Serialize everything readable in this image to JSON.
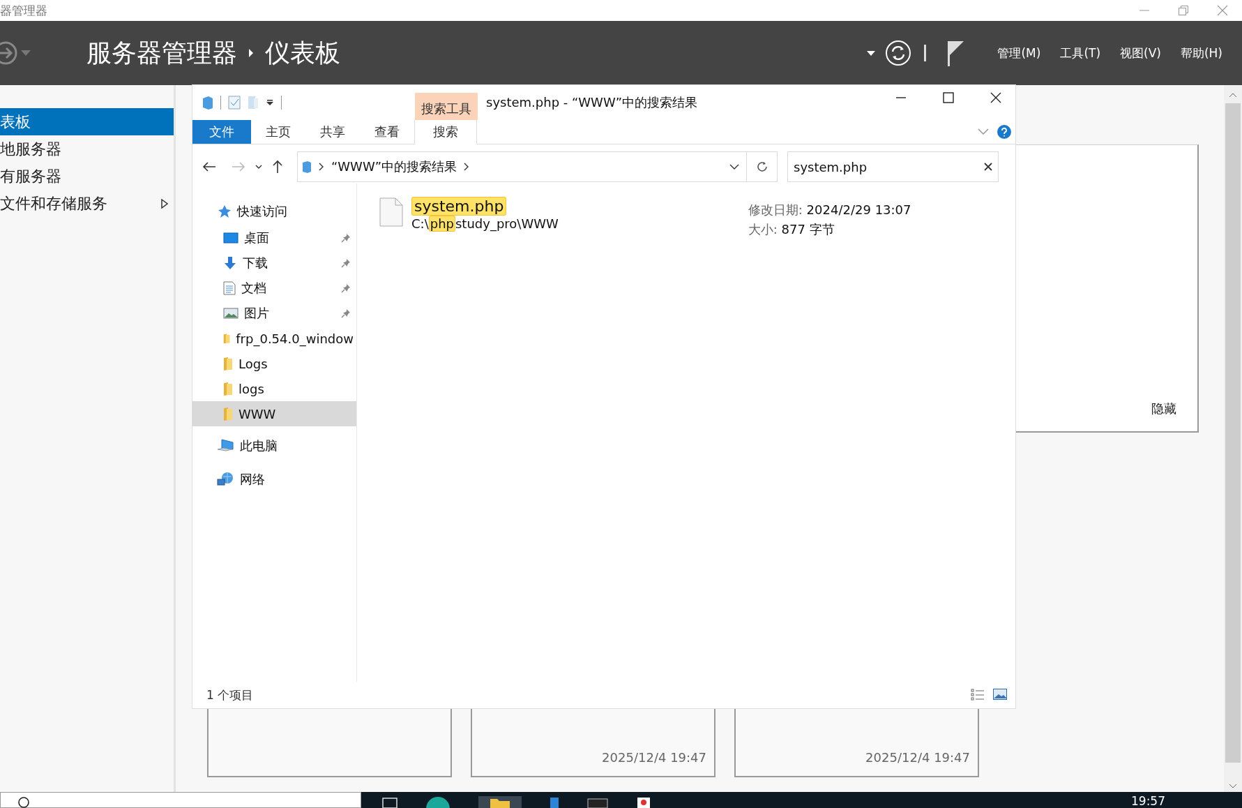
{
  "window": {
    "title": "器管理器"
  },
  "header": {
    "breadcrumb": [
      "服务器管理器",
      "仪表板"
    ],
    "menus": [
      "管理(M)",
      "工具(T)",
      "视图(V)",
      "帮助(H)"
    ]
  },
  "sidebar": {
    "items": [
      {
        "label": "表板",
        "selected": true,
        "expandable": false
      },
      {
        "label": "地服务器",
        "selected": false,
        "expandable": false
      },
      {
        "label": "有服务器",
        "selected": false,
        "expandable": false
      },
      {
        "label": "文件和存储服务",
        "selected": false,
        "expandable": true
      }
    ]
  },
  "dashboard": {
    "panel_link": "隐藏",
    "tiles": [
      {
        "kind": "empty"
      },
      {
        "kind": "dated",
        "timestamp": "2025/12/4 19:47"
      },
      {
        "kind": "dated",
        "timestamp": "2025/12/4 19:47"
      }
    ]
  },
  "explorer": {
    "title": "system.php - “WWW”中的搜索结果",
    "context_tab": "搜索工具",
    "ribbon_tabs": [
      {
        "label": "文件",
        "kind": "file",
        "selected": false
      },
      {
        "label": "主页",
        "kind": "tab",
        "selected": false
      },
      {
        "label": "共享",
        "kind": "tab",
        "selected": false
      },
      {
        "label": "查看",
        "kind": "tab",
        "selected": false
      },
      {
        "label": "搜索",
        "kind": "tab",
        "selected": true
      }
    ],
    "address": "“WWW”中的搜索结果",
    "search": {
      "value": "system.php"
    },
    "nav": [
      {
        "label": "快速访问",
        "kind": "star",
        "selected": false,
        "children": [
          {
            "label": "桌面",
            "kind": "desktop",
            "pinned": true,
            "selected": false
          },
          {
            "label": "下载",
            "kind": "download",
            "pinned": true,
            "selected": false
          },
          {
            "label": "文档",
            "kind": "document",
            "pinned": true,
            "selected": false
          },
          {
            "label": "图片",
            "kind": "pictures",
            "pinned": true,
            "selected": false
          },
          {
            "label": "frp_0.54.0_window",
            "kind": "folder",
            "pinned": false,
            "selected": false
          },
          {
            "label": "Logs",
            "kind": "folder",
            "pinned": false,
            "selected": false
          },
          {
            "label": "logs",
            "kind": "folder",
            "pinned": false,
            "selected": false
          },
          {
            "label": "WWW",
            "kind": "folder",
            "pinned": false,
            "selected": true
          }
        ]
      },
      {
        "label": "此电脑",
        "kind": "pc",
        "selected": false
      },
      {
        "label": "网络",
        "kind": "network",
        "selected": false
      }
    ],
    "results": [
      {
        "name": "system.php",
        "name_match": true,
        "path": [
          {
            "text": "C:\\",
            "match": false
          },
          {
            "text": "php",
            "match": true
          },
          {
            "text": "study_pro\\WWW",
            "match": false
          }
        ],
        "modified_label": "修改日期:",
        "modified": "2024/2/29 13:07",
        "size_label": "大小:",
        "size": "877 字节"
      }
    ],
    "status": "1 个项目"
  },
  "taskbar": {
    "time": "19:57"
  }
}
